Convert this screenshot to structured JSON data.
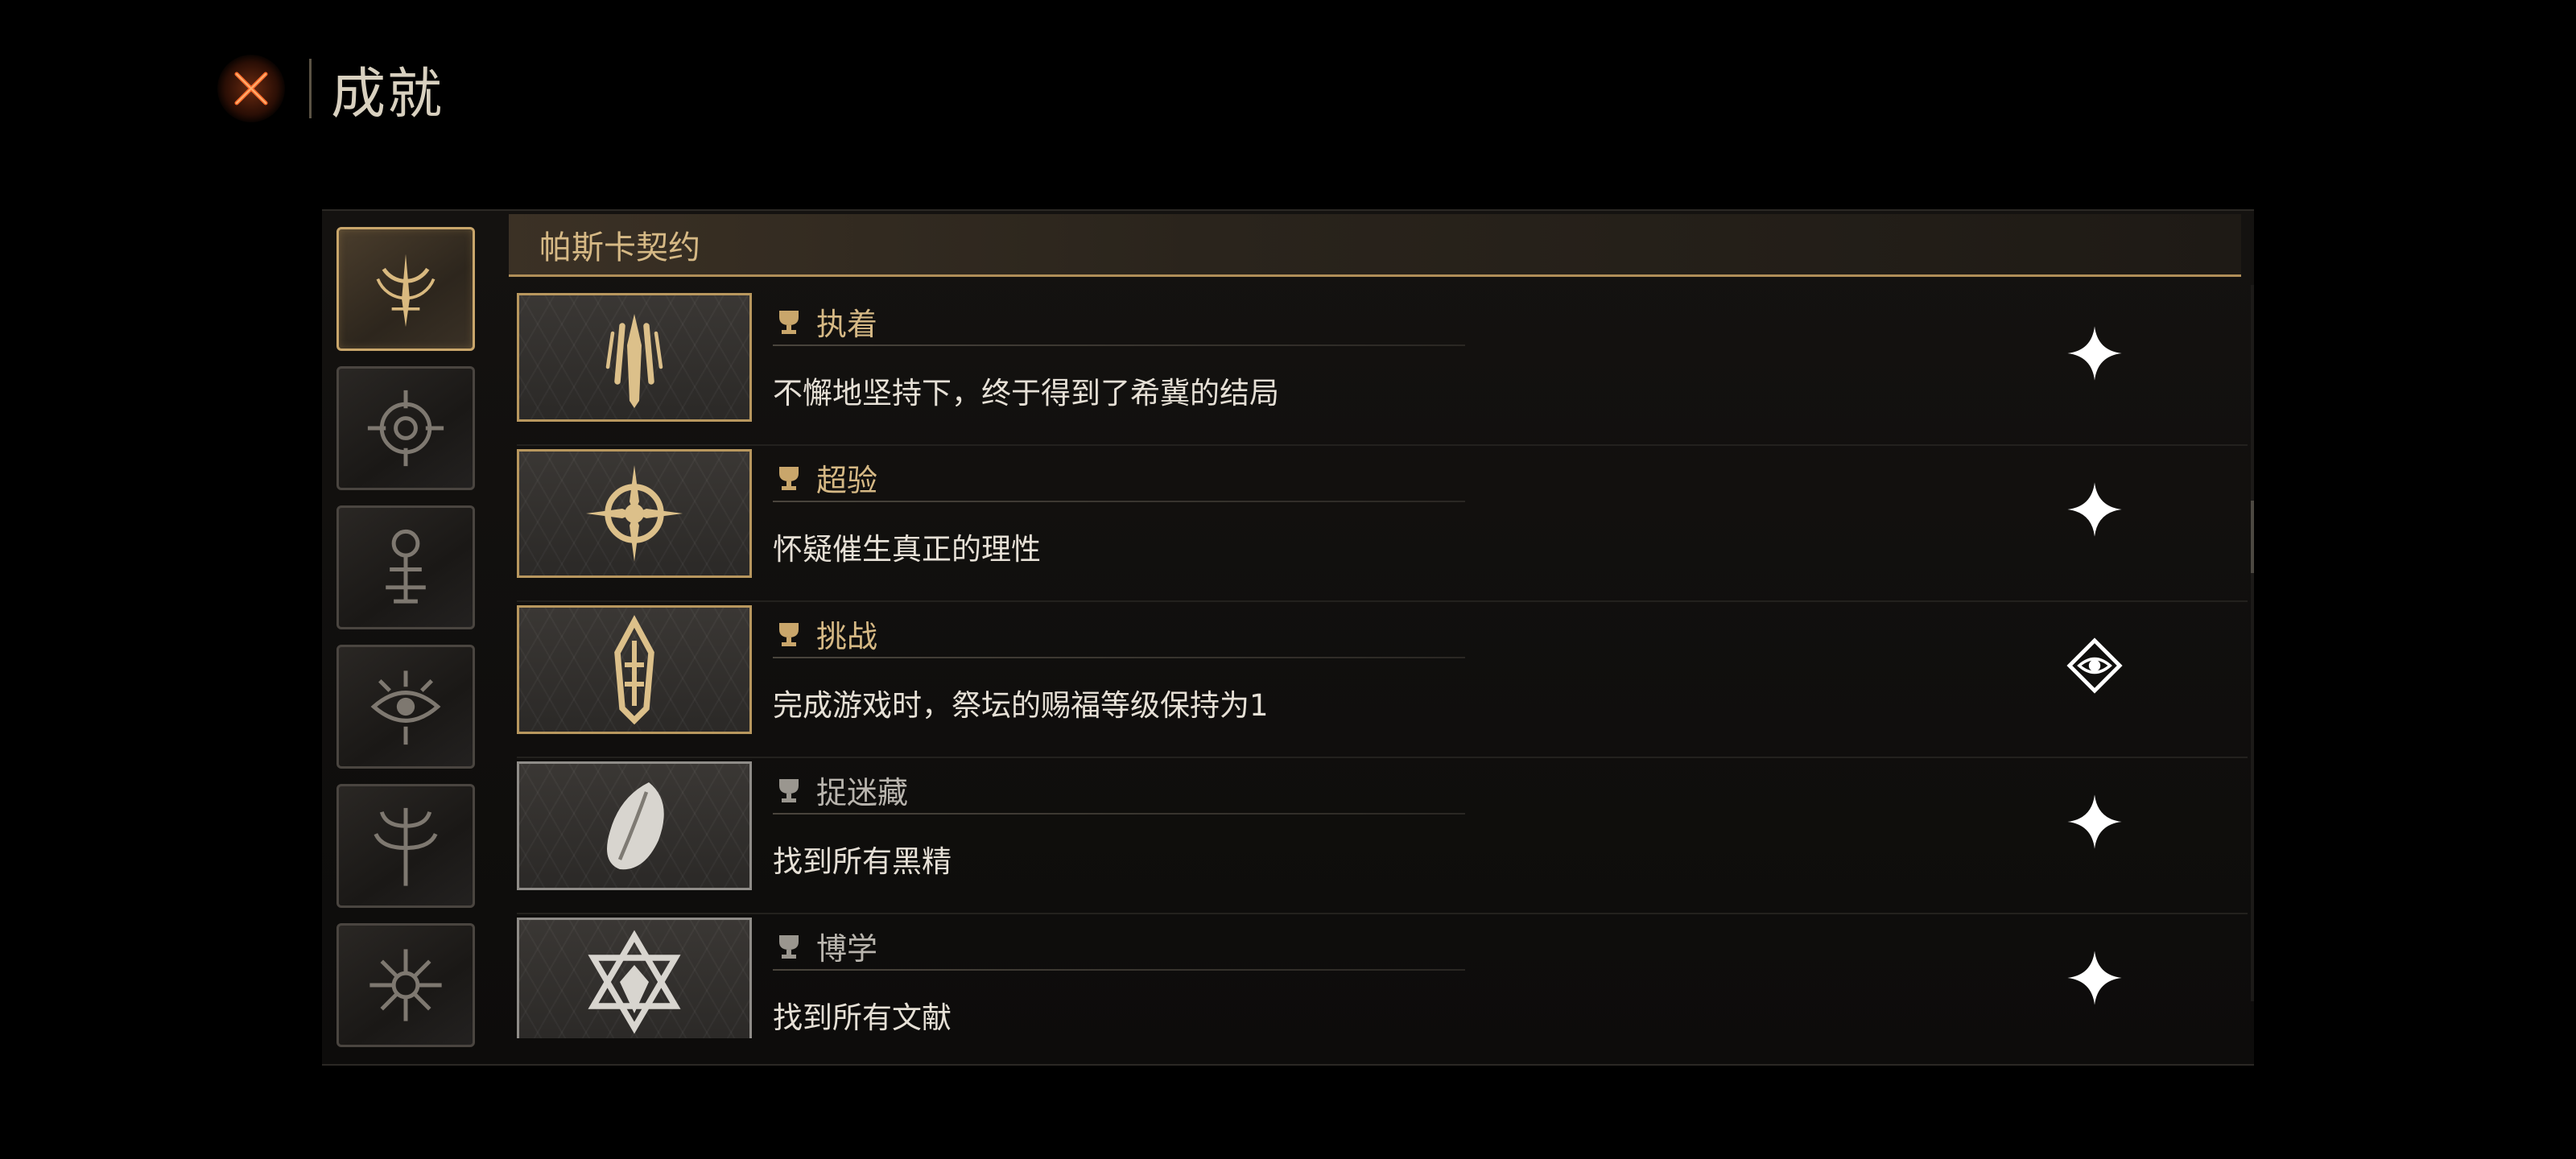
{
  "header": {
    "title": "成就",
    "close_icon": "close-x-icon"
  },
  "categories": [
    {
      "icon": "crescent-spire-icon",
      "active": true
    },
    {
      "icon": "eye-sigil-icon",
      "active": false
    },
    {
      "icon": "idol-totem-icon",
      "active": false
    },
    {
      "icon": "thorn-eye-icon",
      "active": false
    },
    {
      "icon": "tree-sigil-icon",
      "active": false
    },
    {
      "icon": "radiant-sigil-icon",
      "active": false
    }
  ],
  "section": {
    "title": "帕斯卡契约"
  },
  "achievements": [
    {
      "name": "执着",
      "description": "不懈地坚持下，终于得到了希冀的结局",
      "tier": "gold",
      "badge_icon": "claw-totem-icon",
      "status_icon": "sparkle-icon"
    },
    {
      "name": "超验",
      "description": "怀疑催生真正的理性",
      "tier": "gold",
      "badge_icon": "crosshair-star-icon",
      "status_icon": "sparkle-icon"
    },
    {
      "name": "挑战",
      "description": "完成游戏时，祭坛的赐福等级保持为1",
      "tier": "gold",
      "badge_icon": "carved-pillar-icon",
      "status_icon": "diamond-eye-icon"
    },
    {
      "name": "捉迷藏",
      "description": "找到所有黑精",
      "tier": "silver",
      "badge_icon": "seed-stone-icon",
      "status_icon": "sparkle-icon"
    },
    {
      "name": "博学",
      "description": "找到所有文献",
      "tier": "silver",
      "badge_icon": "hexagram-icon",
      "status_icon": "sparkle-icon"
    }
  ],
  "colors": {
    "gold": "#c9a66b",
    "silver": "#9a968f",
    "accent": "#e05a20",
    "background": "#000000"
  }
}
